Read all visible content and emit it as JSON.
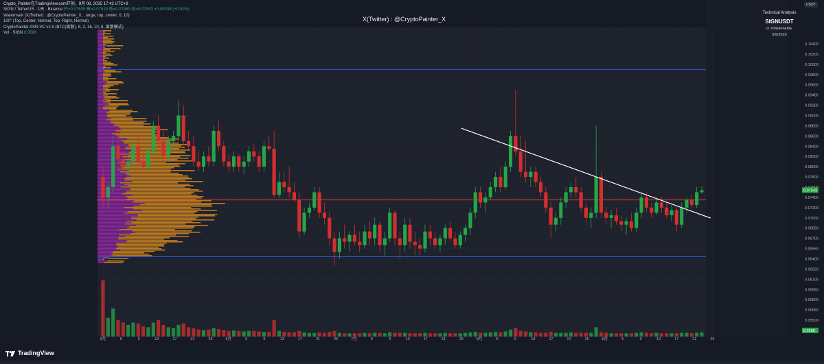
{
  "header": {
    "top_line": "Crypto_Painter在TradingView.com开创，9月 08, 2025 17:42 UTC+8",
    "symbol_line": "SIGN / TetherUS · 1天 · Binance",
    "symbol_values": "开=0.07505  高=0.07618  低=0.07469  收=0.07543  +0.00038 (+0.51%)",
    "watermark_line": "Watermark (X(Twitter) : @CryptoPainter_X, , large, top, center, 0, 10)",
    "watermark_line2": "100\" (Top, Center, Normal, Top, Right, Normal)",
    "indicator_line": "CryptoPainter ASR-VC v1.5 (BTC(离散), 5, 2, 16, 10, 8, 离散模式)",
    "vol_line": "Vol · SIGN",
    "vol_value": "8.958K"
  },
  "watermark": "X(Twitter) : @CryptoPainter_X",
  "info_box": {
    "title": "Technical Analysis",
    "symbol": "SIGNUSDT",
    "timeframe": "D TIMEFRAME",
    "date": "9/9/2025"
  },
  "currency": "USDT",
  "logo": "TradingView",
  "colors": {
    "background": "#1e222d",
    "bull": "#26a649",
    "bear": "#d32f2f",
    "volume_profile_up": "#d88a1e",
    "volume_profile_down": "#9c27b0",
    "support_resistance_line": "#2f57d6",
    "horizontal_red_line": "#e53935",
    "trendline": "#ffffff"
  },
  "chart_data": {
    "type": "candlestick",
    "title": "SIGNUSDT",
    "timeframe": "1D",
    "price_axis_labels": [
      "0.10400",
      "0.10200",
      "0.10000",
      "0.09800",
      "0.09600",
      "0.09400",
      "0.09200",
      "0.09000",
      "0.08800",
      "0.08600",
      "0.08400",
      "0.08200",
      "0.08000",
      "0.07800",
      "0.07600",
      "0.07400",
      "0.07200",
      "0.07000",
      "0.06850",
      "0.06700",
      "0.06550",
      "0.06400",
      "0.06250",
      "0.06100",
      "0.05950",
      "0.05800",
      "0.05650",
      "0.05500",
      "0.05350"
    ],
    "current_price_label": "0.07543",
    "volume_label": "8.958K",
    "time_axis_labels": [
      "5月",
      "5",
      "9",
      "13",
      "17",
      "21",
      "25",
      "6月",
      "5",
      "9",
      "13",
      "17",
      "21",
      "25",
      "7月",
      "5",
      "9",
      "13",
      "17",
      "21",
      "25",
      "8月",
      "5",
      "9",
      "13",
      "17",
      "21",
      "25",
      "9月",
      "5",
      "9",
      "13",
      "17",
      "21",
      "25"
    ],
    "horizontal_levels": [
      {
        "price": 0.099,
        "color": "blue"
      },
      {
        "price": 0.0735,
        "color": "red"
      },
      {
        "price": 0.0643,
        "color": "blue"
      }
    ],
    "trendline": {
      "from": {
        "date": "2025-07-20",
        "price": 0.0875
      },
      "to": {
        "date": "2025-09-09",
        "price": 0.0713
      }
    },
    "candles": [
      {
        "o": 0.078,
        "h": 0.08,
        "l": 0.072,
        "c": 0.074
      },
      {
        "o": 0.074,
        "h": 0.077,
        "l": 0.072,
        "c": 0.076
      },
      {
        "o": 0.076,
        "h": 0.086,
        "l": 0.075,
        "c": 0.084
      },
      {
        "o": 0.084,
        "h": 0.088,
        "l": 0.08,
        "c": 0.0815
      },
      {
        "o": 0.0815,
        "h": 0.083,
        "l": 0.079,
        "c": 0.08
      },
      {
        "o": 0.08,
        "h": 0.082,
        "l": 0.078,
        "c": 0.081
      },
      {
        "o": 0.081,
        "h": 0.085,
        "l": 0.08,
        "c": 0.084
      },
      {
        "o": 0.084,
        "h": 0.086,
        "l": 0.08,
        "c": 0.081
      },
      {
        "o": 0.081,
        "h": 0.083,
        "l": 0.079,
        "c": 0.08
      },
      {
        "o": 0.08,
        "h": 0.084,
        "l": 0.079,
        "c": 0.083
      },
      {
        "o": 0.083,
        "h": 0.089,
        "l": 0.082,
        "c": 0.088
      },
      {
        "o": 0.088,
        "h": 0.09,
        "l": 0.084,
        "c": 0.085
      },
      {
        "o": 0.085,
        "h": 0.087,
        "l": 0.081,
        "c": 0.082
      },
      {
        "o": 0.082,
        "h": 0.086,
        "l": 0.081,
        "c": 0.085
      },
      {
        "o": 0.085,
        "h": 0.087,
        "l": 0.083,
        "c": 0.086
      },
      {
        "o": 0.086,
        "h": 0.093,
        "l": 0.085,
        "c": 0.09
      },
      {
        "o": 0.09,
        "h": 0.092,
        "l": 0.084,
        "c": 0.085
      },
      {
        "o": 0.085,
        "h": 0.087,
        "l": 0.083,
        "c": 0.084
      },
      {
        "o": 0.084,
        "h": 0.086,
        "l": 0.08,
        "c": 0.081
      },
      {
        "o": 0.081,
        "h": 0.083,
        "l": 0.079,
        "c": 0.08
      },
      {
        "o": 0.08,
        "h": 0.083,
        "l": 0.079,
        "c": 0.082
      },
      {
        "o": 0.082,
        "h": 0.084,
        "l": 0.08,
        "c": 0.081
      },
      {
        "o": 0.081,
        "h": 0.088,
        "l": 0.08,
        "c": 0.087
      },
      {
        "o": 0.087,
        "h": 0.089,
        "l": 0.083,
        "c": 0.084
      },
      {
        "o": 0.084,
        "h": 0.085,
        "l": 0.08,
        "c": 0.081
      },
      {
        "o": 0.081,
        "h": 0.0825,
        "l": 0.079,
        "c": 0.08
      },
      {
        "o": 0.08,
        "h": 0.083,
        "l": 0.079,
        "c": 0.082
      },
      {
        "o": 0.082,
        "h": 0.0825,
        "l": 0.079,
        "c": 0.08
      },
      {
        "o": 0.08,
        "h": 0.082,
        "l": 0.0785,
        "c": 0.081
      },
      {
        "o": 0.081,
        "h": 0.084,
        "l": 0.08,
        "c": 0.083
      },
      {
        "o": 0.083,
        "h": 0.0845,
        "l": 0.081,
        "c": 0.082
      },
      {
        "o": 0.082,
        "h": 0.083,
        "l": 0.079,
        "c": 0.08
      },
      {
        "o": 0.08,
        "h": 0.085,
        "l": 0.079,
        "c": 0.084
      },
      {
        "o": 0.084,
        "h": 0.086,
        "l": 0.083,
        "c": 0.0835
      },
      {
        "o": 0.0835,
        "h": 0.087,
        "l": 0.074,
        "c": 0.0745
      },
      {
        "o": 0.0745,
        "h": 0.079,
        "l": 0.074,
        "c": 0.077
      },
      {
        "o": 0.077,
        "h": 0.079,
        "l": 0.075,
        "c": 0.076
      },
      {
        "o": 0.076,
        "h": 0.08,
        "l": 0.074,
        "c": 0.075
      },
      {
        "o": 0.075,
        "h": 0.077,
        "l": 0.073,
        "c": 0.0735
      },
      {
        "o": 0.0735,
        "h": 0.075,
        "l": 0.067,
        "c": 0.068
      },
      {
        "o": 0.068,
        "h": 0.072,
        "l": 0.0675,
        "c": 0.071
      },
      {
        "o": 0.071,
        "h": 0.073,
        "l": 0.07,
        "c": 0.072
      },
      {
        "o": 0.072,
        "h": 0.076,
        "l": 0.0715,
        "c": 0.075
      },
      {
        "o": 0.075,
        "h": 0.076,
        "l": 0.07,
        "c": 0.071
      },
      {
        "o": 0.071,
        "h": 0.073,
        "l": 0.069,
        "c": 0.07
      },
      {
        "o": 0.07,
        "h": 0.071,
        "l": 0.066,
        "c": 0.067
      },
      {
        "o": 0.067,
        "h": 0.068,
        "l": 0.063,
        "c": 0.065
      },
      {
        "o": 0.065,
        "h": 0.068,
        "l": 0.064,
        "c": 0.067
      },
      {
        "o": 0.067,
        "h": 0.069,
        "l": 0.0655,
        "c": 0.0665
      },
      {
        "o": 0.0665,
        "h": 0.068,
        "l": 0.065,
        "c": 0.0675
      },
      {
        "o": 0.0675,
        "h": 0.069,
        "l": 0.066,
        "c": 0.0665
      },
      {
        "o": 0.0665,
        "h": 0.068,
        "l": 0.065,
        "c": 0.066
      },
      {
        "o": 0.066,
        "h": 0.069,
        "l": 0.0655,
        "c": 0.068
      },
      {
        "o": 0.068,
        "h": 0.0695,
        "l": 0.066,
        "c": 0.067
      },
      {
        "o": 0.067,
        "h": 0.07,
        "l": 0.066,
        "c": 0.069
      },
      {
        "o": 0.069,
        "h": 0.0695,
        "l": 0.065,
        "c": 0.066
      },
      {
        "o": 0.066,
        "h": 0.068,
        "l": 0.0645,
        "c": 0.067
      },
      {
        "o": 0.067,
        "h": 0.072,
        "l": 0.0665,
        "c": 0.071
      },
      {
        "o": 0.071,
        "h": 0.0715,
        "l": 0.066,
        "c": 0.067
      },
      {
        "o": 0.067,
        "h": 0.068,
        "l": 0.064,
        "c": 0.066
      },
      {
        "o": 0.066,
        "h": 0.07,
        "l": 0.065,
        "c": 0.069
      },
      {
        "o": 0.069,
        "h": 0.07,
        "l": 0.0655,
        "c": 0.0665
      },
      {
        "o": 0.0665,
        "h": 0.068,
        "l": 0.0645,
        "c": 0.066
      },
      {
        "o": 0.066,
        "h": 0.067,
        "l": 0.0645,
        "c": 0.0655
      },
      {
        "o": 0.0655,
        "h": 0.069,
        "l": 0.065,
        "c": 0.068
      },
      {
        "o": 0.068,
        "h": 0.069,
        "l": 0.066,
        "c": 0.067
      },
      {
        "o": 0.067,
        "h": 0.068,
        "l": 0.0655,
        "c": 0.066
      },
      {
        "o": 0.066,
        "h": 0.0675,
        "l": 0.065,
        "c": 0.067
      },
      {
        "o": 0.067,
        "h": 0.069,
        "l": 0.066,
        "c": 0.0685
      },
      {
        "o": 0.0685,
        "h": 0.0695,
        "l": 0.0665,
        "c": 0.067
      },
      {
        "o": 0.067,
        "h": 0.068,
        "l": 0.0655,
        "c": 0.066
      },
      {
        "o": 0.066,
        "h": 0.068,
        "l": 0.0655,
        "c": 0.0675
      },
      {
        "o": 0.0675,
        "h": 0.069,
        "l": 0.0665,
        "c": 0.0685
      },
      {
        "o": 0.0685,
        "h": 0.072,
        "l": 0.0675,
        "c": 0.071
      },
      {
        "o": 0.071,
        "h": 0.076,
        "l": 0.07,
        "c": 0.075
      },
      {
        "o": 0.075,
        "h": 0.076,
        "l": 0.072,
        "c": 0.073
      },
      {
        "o": 0.073,
        "h": 0.075,
        "l": 0.071,
        "c": 0.074
      },
      {
        "o": 0.074,
        "h": 0.077,
        "l": 0.0735,
        "c": 0.076
      },
      {
        "o": 0.076,
        "h": 0.079,
        "l": 0.075,
        "c": 0.078
      },
      {
        "o": 0.078,
        "h": 0.08,
        "l": 0.075,
        "c": 0.076
      },
      {
        "o": 0.076,
        "h": 0.081,
        "l": 0.0755,
        "c": 0.08
      },
      {
        "o": 0.08,
        "h": 0.087,
        "l": 0.079,
        "c": 0.086
      },
      {
        "o": 0.086,
        "h": 0.095,
        "l": 0.082,
        "c": 0.083
      },
      {
        "o": 0.083,
        "h": 0.086,
        "l": 0.078,
        "c": 0.079
      },
      {
        "o": 0.079,
        "h": 0.085,
        "l": 0.077,
        "c": 0.078
      },
      {
        "o": 0.078,
        "h": 0.08,
        "l": 0.076,
        "c": 0.079
      },
      {
        "o": 0.079,
        "h": 0.08,
        "l": 0.076,
        "c": 0.077
      },
      {
        "o": 0.077,
        "h": 0.078,
        "l": 0.074,
        "c": 0.075
      },
      {
        "o": 0.075,
        "h": 0.076,
        "l": 0.071,
        "c": 0.072
      },
      {
        "o": 0.072,
        "h": 0.073,
        "l": 0.067,
        "c": 0.069
      },
      {
        "o": 0.069,
        "h": 0.071,
        "l": 0.068,
        "c": 0.07
      },
      {
        "o": 0.07,
        "h": 0.074,
        "l": 0.069,
        "c": 0.073
      },
      {
        "o": 0.073,
        "h": 0.076,
        "l": 0.072,
        "c": 0.075
      },
      {
        "o": 0.075,
        "h": 0.077,
        "l": 0.074,
        "c": 0.076
      },
      {
        "o": 0.076,
        "h": 0.078,
        "l": 0.074,
        "c": 0.075
      },
      {
        "o": 0.075,
        "h": 0.076,
        "l": 0.071,
        "c": 0.072
      },
      {
        "o": 0.072,
        "h": 0.073,
        "l": 0.069,
        "c": 0.07
      },
      {
        "o": 0.07,
        "h": 0.072,
        "l": 0.0685,
        "c": 0.071
      },
      {
        "o": 0.071,
        "h": 0.088,
        "l": 0.07,
        "c": 0.078
      },
      {
        "o": 0.078,
        "h": 0.079,
        "l": 0.07,
        "c": 0.071
      },
      {
        "o": 0.071,
        "h": 0.072,
        "l": 0.069,
        "c": 0.07
      },
      {
        "o": 0.07,
        "h": 0.0715,
        "l": 0.0685,
        "c": 0.0705
      },
      {
        "o": 0.0705,
        "h": 0.072,
        "l": 0.069,
        "c": 0.0695
      },
      {
        "o": 0.0695,
        "h": 0.0705,
        "l": 0.068,
        "c": 0.069
      },
      {
        "o": 0.069,
        "h": 0.07,
        "l": 0.0675,
        "c": 0.0695
      },
      {
        "o": 0.0695,
        "h": 0.071,
        "l": 0.068,
        "c": 0.0685
      },
      {
        "o": 0.0685,
        "h": 0.072,
        "l": 0.068,
        "c": 0.071
      },
      {
        "o": 0.071,
        "h": 0.075,
        "l": 0.07,
        "c": 0.074
      },
      {
        "o": 0.074,
        "h": 0.075,
        "l": 0.071,
        "c": 0.072
      },
      {
        "o": 0.072,
        "h": 0.073,
        "l": 0.07,
        "c": 0.071
      },
      {
        "o": 0.071,
        "h": 0.074,
        "l": 0.0705,
        "c": 0.073
      },
      {
        "o": 0.073,
        "h": 0.074,
        "l": 0.071,
        "c": 0.072
      },
      {
        "o": 0.072,
        "h": 0.073,
        "l": 0.07,
        "c": 0.0705
      },
      {
        "o": 0.0705,
        "h": 0.0725,
        "l": 0.0695,
        "c": 0.0715
      },
      {
        "o": 0.0715,
        "h": 0.072,
        "l": 0.068,
        "c": 0.069
      },
      {
        "o": 0.069,
        "h": 0.073,
        "l": 0.0685,
        "c": 0.072
      },
      {
        "o": 0.072,
        "h": 0.074,
        "l": 0.071,
        "c": 0.0735
      },
      {
        "o": 0.0735,
        "h": 0.0745,
        "l": 0.072,
        "c": 0.0725
      },
      {
        "o": 0.0725,
        "h": 0.076,
        "l": 0.072,
        "c": 0.075
      },
      {
        "o": 0.075,
        "h": 0.0762,
        "l": 0.0747,
        "c": 0.0754
      }
    ],
    "volume": [
      120,
      40,
      60,
      35,
      30,
      25,
      30,
      28,
      22,
      20,
      30,
      35,
      25,
      20,
      18,
      25,
      28,
      20,
      18,
      15,
      14,
      15,
      18,
      16,
      14,
      12,
      13,
      12,
      11,
      12,
      12,
      11,
      10,
      10,
      35,
      12,
      10,
      9,
      9,
      12,
      9,
      8,
      8,
      9,
      8,
      10,
      12,
      8,
      7,
      7,
      7,
      7,
      8,
      7,
      8,
      8,
      7,
      9,
      8,
      8,
      8,
      7,
      7,
      7,
      8,
      7,
      7,
      7,
      8,
      7,
      7,
      7,
      8,
      9,
      10,
      8,
      8,
      9,
      10,
      9,
      11,
      15,
      18,
      12,
      11,
      9,
      9,
      8,
      8,
      10,
      8,
      8,
      8,
      9,
      8,
      8,
      8,
      8,
      20,
      9,
      8,
      7,
      7,
      7,
      7,
      7,
      8,
      9,
      8,
      7,
      8,
      7,
      7,
      7,
      7,
      8,
      8,
      7,
      8,
      9
    ]
  }
}
